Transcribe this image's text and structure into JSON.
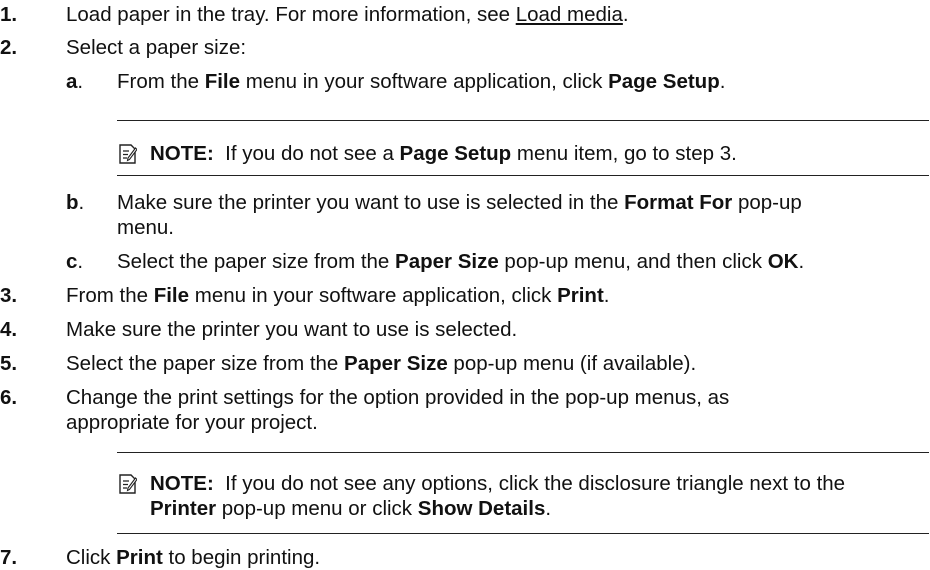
{
  "steps": [
    {
      "num": "1.",
      "pre": "Load paper in the tray. For more information, see ",
      "link": "Load media",
      "post": "."
    },
    {
      "num": "2.",
      "text": "Select a paper size:"
    },
    {
      "num": "3.",
      "t1": "From the ",
      "b1": "File",
      "t2": " menu in your software application, click ",
      "b2": "Print",
      "t3": "."
    },
    {
      "num": "4.",
      "text": "Make sure the printer you want to use is selected."
    },
    {
      "num": "5.",
      "t1": "Select the paper size from the ",
      "b1": "Paper Size",
      "t2": " pop-up menu (if available)."
    },
    {
      "num": "6.",
      "line1": "Change the print settings for the option provided in the pop-up menus, as",
      "line2": "appropriate for your project."
    },
    {
      "num": "7.",
      "t1": "Click ",
      "b1": "Print",
      "t2": " to begin printing."
    }
  ],
  "substeps": [
    {
      "letter": "a",
      "t1": "From the ",
      "b1": "File",
      "t2": " menu in your software application, click ",
      "b2": "Page Setup",
      "t3": "."
    },
    {
      "letter": "b",
      "t1": "Make sure the printer you want to use is selected in the ",
      "b1": "Format For",
      "t2": " pop-up",
      "line2": "menu."
    },
    {
      "letter": "c",
      "t1": "Select the paper size from the ",
      "b1": "Paper Size",
      "t2": " pop-up menu, and then click ",
      "b2": "OK",
      "t3": "."
    }
  ],
  "letter_suffix": ".",
  "notes": [
    {
      "icon": "note-icon",
      "label": "NOTE:",
      "t1": "  If you do not see a ",
      "b1": "Page Setup",
      "t2": " menu item, go to step 3."
    },
    {
      "icon": "note-icon",
      "label": "NOTE:",
      "t1": "  If you do not see any options, click the disclosure triangle next to the",
      "b1": "Printer",
      "t2": " pop-up menu or click ",
      "b2": "Show Details",
      "t3": "."
    }
  ]
}
